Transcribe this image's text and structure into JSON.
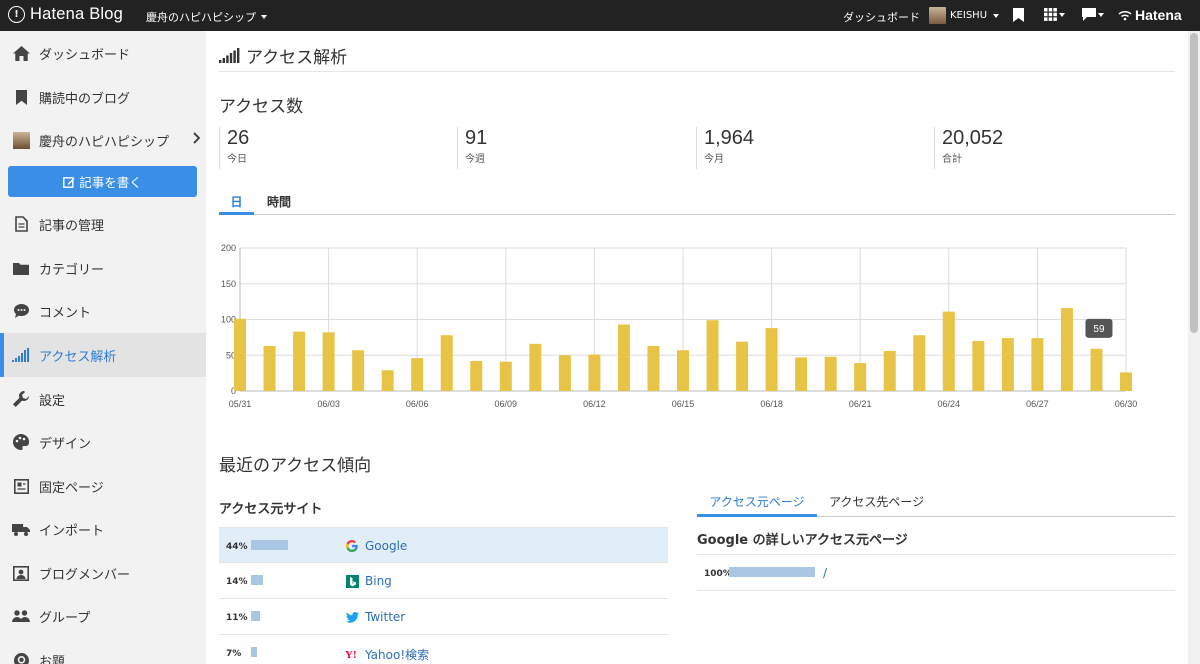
{
  "topbar": {
    "logo": "Hatena Blog",
    "blog_name": "慶舟のハピハピシップ",
    "dashboard": "ダッシュボード",
    "user_name": "KEISHU",
    "brand": "Hatena"
  },
  "sidebar": {
    "items": [
      {
        "label": "ダッシュボード",
        "icon": "home-icon"
      },
      {
        "label": "購読中のブログ",
        "icon": "bookmark-icon"
      },
      {
        "label": "慶舟のハピハピシップ",
        "icon": "blog-avatar"
      },
      {
        "label": "記事の管理",
        "icon": "document-icon"
      },
      {
        "label": "カテゴリー",
        "icon": "folder-icon"
      },
      {
        "label": "コメント",
        "icon": "comment-icon"
      },
      {
        "label": "アクセス解析",
        "icon": "signal-icon"
      },
      {
        "label": "設定",
        "icon": "wrench-icon"
      },
      {
        "label": "デザイン",
        "icon": "palette-icon"
      },
      {
        "label": "固定ページ",
        "icon": "page-icon"
      },
      {
        "label": "インポート",
        "icon": "truck-icon"
      },
      {
        "label": "ブログメンバー",
        "icon": "member-icon"
      },
      {
        "label": "グループ",
        "icon": "group-icon"
      },
      {
        "label": "お題",
        "icon": "theme-icon"
      }
    ],
    "write_button": "記事を書く"
  },
  "main": {
    "page_title": "アクセス解析",
    "access_heading": "アクセス数",
    "stats": [
      {
        "value": "26",
        "label": "今日"
      },
      {
        "value": "91",
        "label": "今週"
      },
      {
        "value": "1,964",
        "label": "今月"
      },
      {
        "value": "20,052",
        "label": "合計"
      }
    ],
    "tabs": [
      "日",
      "時間"
    ],
    "trend_heading": "最近のアクセス傾向",
    "sources_title": "アクセス元サイト",
    "sources": [
      {
        "pct": "44%",
        "name": "Google",
        "share": 44
      },
      {
        "pct": "14%",
        "name": "Bing",
        "share": 14
      },
      {
        "pct": "11%",
        "name": "Twitter",
        "share": 11
      },
      {
        "pct": "7%",
        "name": "Yahoo!検索",
        "share": 7
      }
    ],
    "right_tabs": [
      "アクセス元ページ",
      "アクセス先ページ"
    ],
    "google_detail_title": "Google の詳しいアクセス元ページ",
    "dest_rows": [
      {
        "pct": "100%",
        "path": "/",
        "share": 100
      }
    ]
  },
  "chart_data": {
    "type": "bar",
    "categories": [
      "05/31",
      "06/01",
      "06/02",
      "06/03",
      "06/04",
      "06/05",
      "06/06",
      "06/07",
      "06/08",
      "06/09",
      "06/10",
      "06/11",
      "06/12",
      "06/13",
      "06/14",
      "06/15",
      "06/16",
      "06/17",
      "06/18",
      "06/19",
      "06/20",
      "06/21",
      "06/22",
      "06/23",
      "06/24",
      "06/25",
      "06/26",
      "06/27",
      "06/28",
      "06/29",
      "06/30"
    ],
    "x_tick_labels": [
      "05/31",
      "06/03",
      "06/06",
      "06/09",
      "06/12",
      "06/15",
      "06/18",
      "06/21",
      "06/24",
      "06/27",
      "06/30"
    ],
    "values": [
      101,
      63,
      83,
      82,
      57,
      29,
      46,
      78,
      42,
      41,
      66,
      50,
      51,
      93,
      63,
      57,
      99,
      69,
      88,
      47,
      48,
      39,
      56,
      78,
      111,
      70,
      74,
      74,
      116,
      59,
      26
    ],
    "ylim": [
      0,
      200
    ],
    "yticks": [
      0,
      50,
      100,
      150,
      200
    ],
    "grid": true,
    "bar_color": "#e8c446",
    "tooltip": {
      "label": "59"
    }
  },
  "colors": {
    "accent": "#3a8ee6",
    "bar": "#e8c446",
    "link": "#2b6fb9",
    "topbar": "#222222"
  }
}
